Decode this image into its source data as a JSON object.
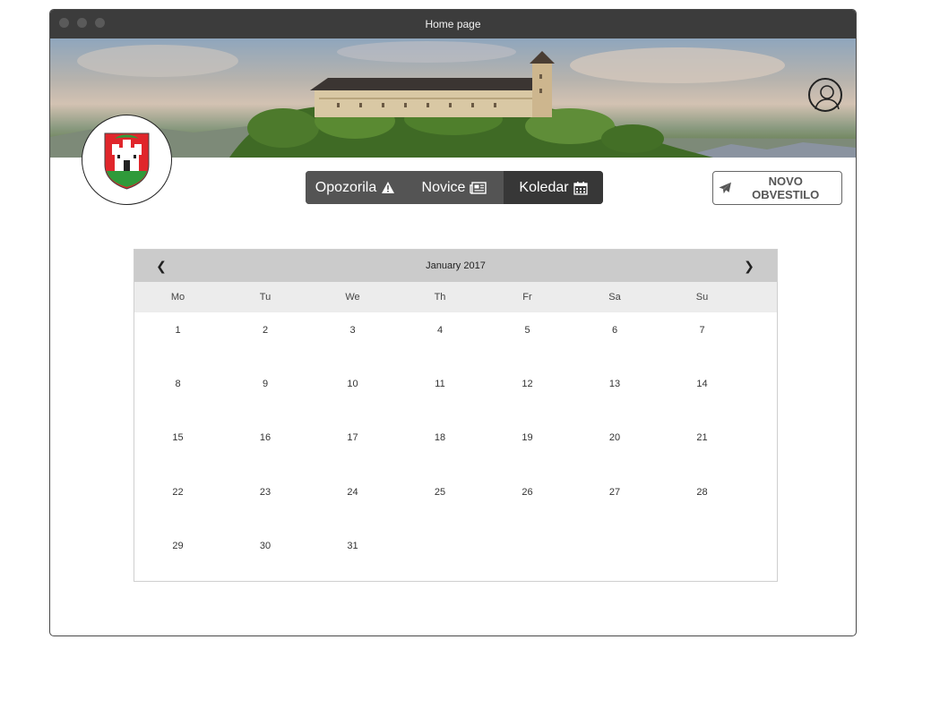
{
  "window": {
    "title": "Home page"
  },
  "tabs": [
    {
      "label": "Opozorila",
      "icon": "warning-icon"
    },
    {
      "label": "Novice",
      "icon": "newspaper-icon"
    },
    {
      "label": "Koledar",
      "icon": "calendar-icon",
      "active": true
    }
  ],
  "new_notification": {
    "label": "NOVO OBVESTILO",
    "icon": "paper-plane-icon"
  },
  "calendar": {
    "month": "January 2017",
    "prev": "❮",
    "next": "❯",
    "weekdays": [
      "Mo",
      "Tu",
      "We",
      "Th",
      "Fr",
      "Sa",
      "Su"
    ],
    "weeks": [
      [
        "1",
        "2",
        "3",
        "4",
        "5",
        "6",
        "7"
      ],
      [
        "8",
        "9",
        "10",
        "11",
        "12",
        "13",
        "14"
      ],
      [
        "15",
        "16",
        "17",
        "18",
        "19",
        "20",
        "21"
      ],
      [
        "22",
        "23",
        "24",
        "25",
        "26",
        "27",
        "28"
      ],
      [
        "29",
        "30",
        "31"
      ]
    ]
  },
  "colors": {
    "titlebar": "#3c3c3c",
    "tab_bg": "#545454",
    "tab_active": "#373737",
    "calendar_header": "#cbcbcb",
    "weekday_row": "#ececec",
    "crest_red": "#e0262b",
    "crest_green": "#2f9a3a"
  }
}
